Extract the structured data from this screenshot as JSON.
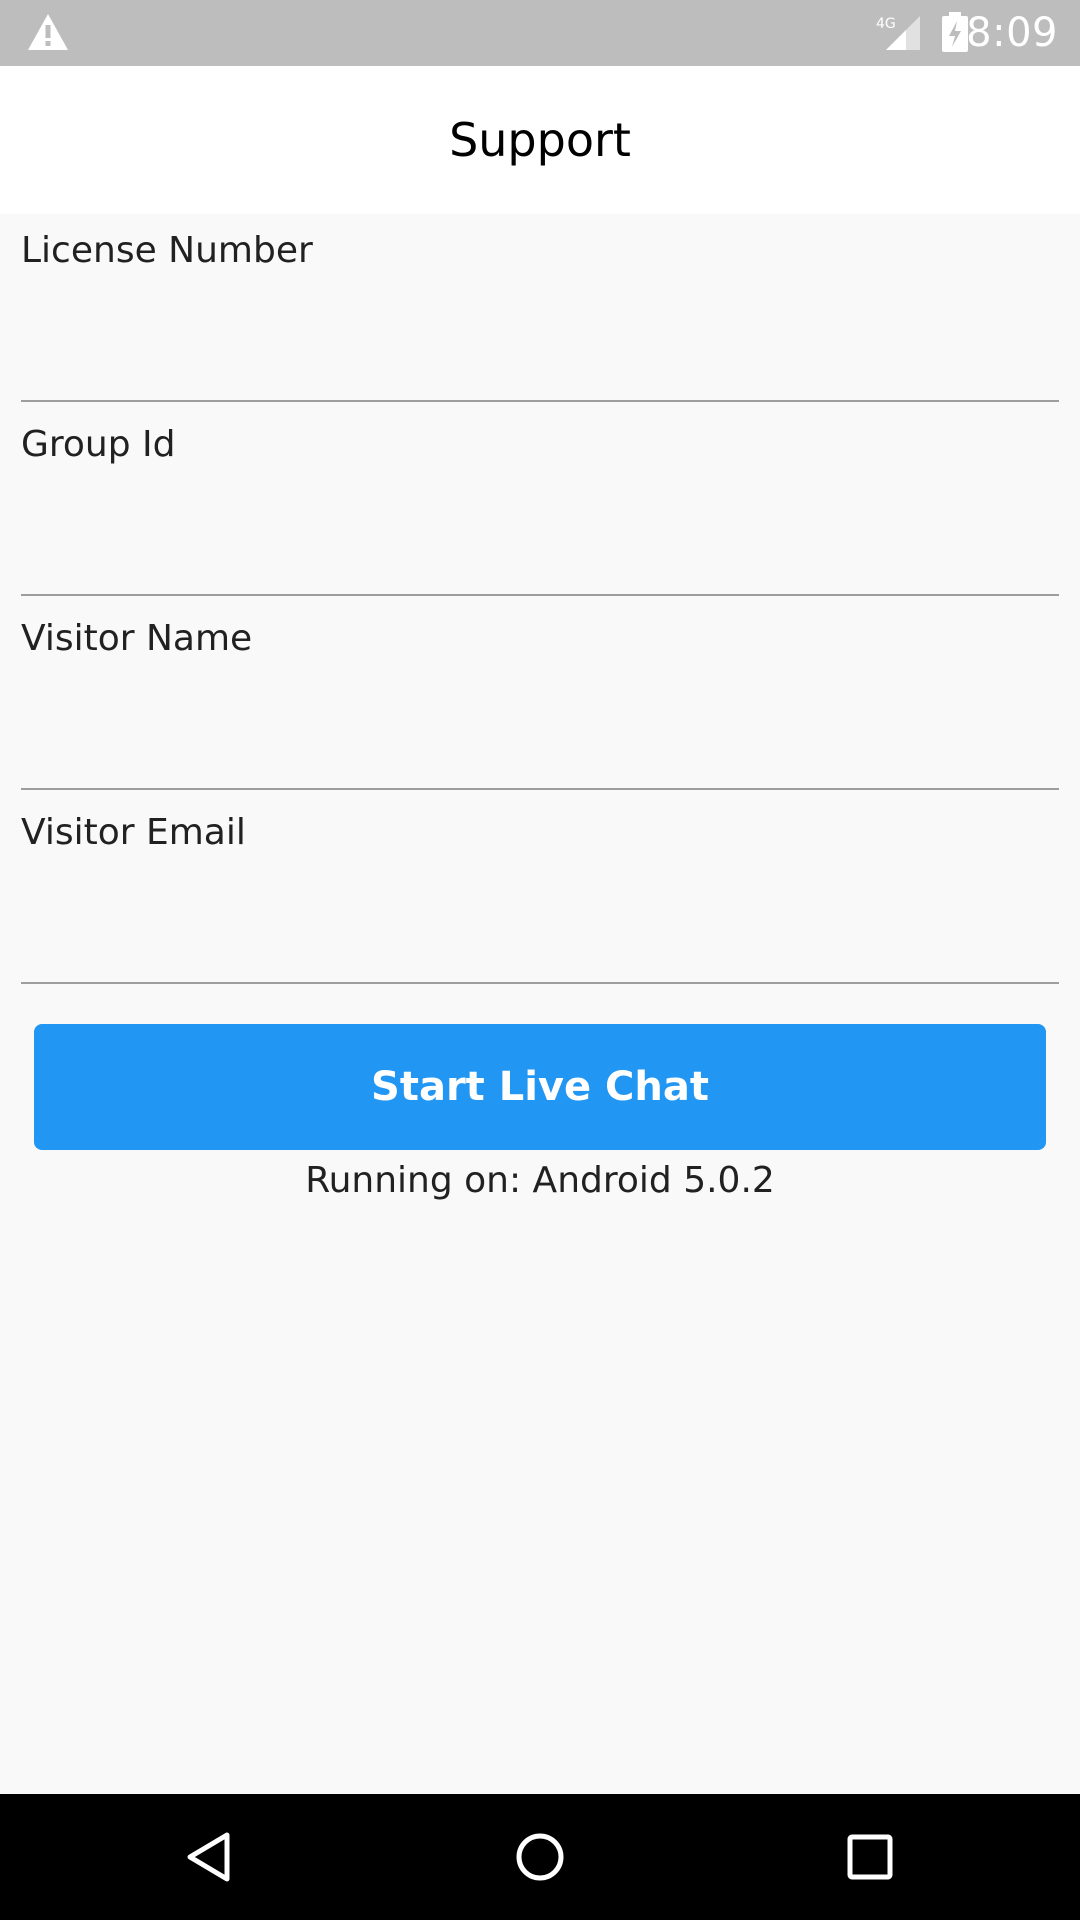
{
  "status_bar": {
    "time": "8:09",
    "network_label": "4G",
    "icons": [
      "warning-icon",
      "signal-icon",
      "battery-charging-icon"
    ]
  },
  "app_bar": {
    "title": "Support"
  },
  "form": {
    "fields": [
      {
        "label": "License Number",
        "value": ""
      },
      {
        "label": "Group Id",
        "value": ""
      },
      {
        "label": "Visitor Name",
        "value": ""
      },
      {
        "label": "Visitor Email",
        "value": ""
      }
    ]
  },
  "actions": {
    "start_chat_label": "Start Live Chat"
  },
  "footer": {
    "running_on": "Running on: Android 5.0.2"
  },
  "nav_bar": {
    "icons": [
      "back-icon",
      "home-icon",
      "recents-icon"
    ]
  },
  "colors": {
    "status_bar": "#bdbdbd",
    "accent": "#2196f3",
    "background": "#f9f9f9",
    "divider": "#9e9e9e"
  }
}
